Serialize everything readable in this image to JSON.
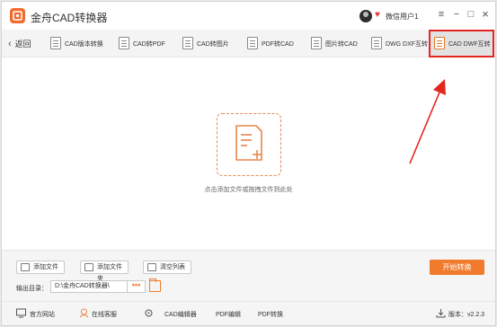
{
  "app": {
    "title": "金舟CAD转换器"
  },
  "user": {
    "name": "微信用户1"
  },
  "window_controls": {
    "menu": "≡",
    "minimize": "−",
    "maximize": "□",
    "close": "×"
  },
  "toolbar": {
    "back_label": "返回",
    "tools": [
      {
        "label": "CAD版本转换",
        "icon": "cad-version-icon"
      },
      {
        "label": "CAD转PDF",
        "icon": "cad-to-pdf-icon"
      },
      {
        "label": "CAD转图片",
        "icon": "cad-to-image-icon"
      },
      {
        "label": "PDF转CAD",
        "icon": "pdf-to-cad-icon"
      },
      {
        "label": "图片转CAD",
        "icon": "image-to-cad-icon"
      },
      {
        "label": "DWG DXF互转",
        "icon": "dwg-dxf-icon"
      },
      {
        "label": "CAD DWF互转",
        "icon": "cad-dwf-icon",
        "active": true
      }
    ]
  },
  "dropzone": {
    "hint": "点击添加文件或拖拽文件到此处"
  },
  "panel": {
    "add_file": "添加文件",
    "add_folder": "添加文件夹",
    "clear_list": "清空列表",
    "start": "开始转换",
    "output_label": "输出目录：",
    "output_path": "D:\\金舟CAD转换器\\",
    "browse": "•••"
  },
  "footer": {
    "website": "官方网站",
    "support": "在线客服",
    "cad_editor": "CAD编辑器",
    "pdf_editor": "PDF编辑",
    "pdf_convert": "PDF转换",
    "version": "版本：v2.2.3"
  },
  "colors": {
    "accent": "#f07b2d",
    "highlight_border": "#e5261f"
  }
}
